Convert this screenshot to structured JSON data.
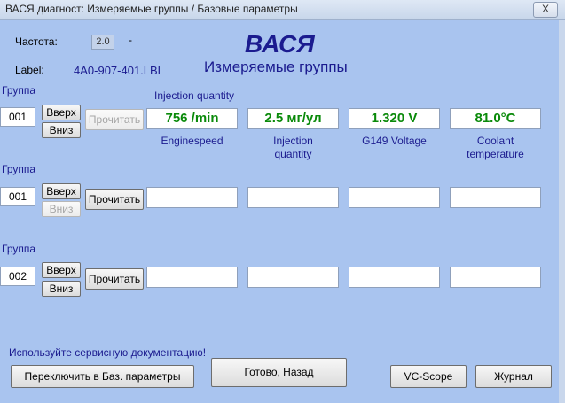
{
  "window": {
    "title": "ВАСЯ диагност: Измеряемые группы / Базовые параметры",
    "close_label": "X"
  },
  "header": {
    "freq_label": "Частота:",
    "freq_value": "2.0",
    "freq_dash": "-",
    "label_caption": "Label:",
    "label_value": "4A0-907-401.LBL",
    "app_name": "ВАСЯ",
    "subtitle": "Измеряемые группы",
    "measure_title": "Injection quantity"
  },
  "groups": [
    {
      "label": "Группа",
      "number": "001",
      "up": "Вверх",
      "down": "Вниз",
      "read": "Прочитать",
      "values": [
        "756 /min",
        "2.5 мг/ул",
        "1.320 V",
        "81.0°C"
      ],
      "captions": [
        "Enginespeed",
        "Injection\nquantity",
        "G149 Voltage",
        "Coolant\ntemperature"
      ]
    },
    {
      "label": "Группа",
      "number": "001",
      "up": "Вверх",
      "down": "Вниз",
      "read": "Прочитать",
      "values": [
        "",
        "",
        "",
        ""
      ]
    },
    {
      "label": "Группа",
      "number": "002",
      "up": "Вверх",
      "down": "Вниз",
      "read": "Прочитать",
      "values": [
        "",
        "",
        "",
        ""
      ]
    }
  ],
  "footer": {
    "notice": "Используйте сервисную документацию!",
    "switch_button": "Переключить в Баз. параметры",
    "done_button": "Готово, Назад",
    "vcscope_button": "VC-Scope",
    "journal_button": "Журнал"
  },
  "colors": {
    "client_bg": "#a9c4ef",
    "title_color": "#1b1b8f",
    "value_color": "#0a8a0a"
  }
}
